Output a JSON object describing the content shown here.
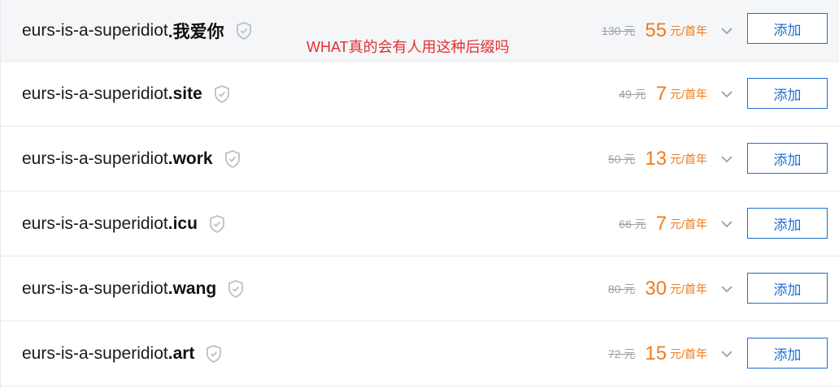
{
  "annotation": "WHAT真的会有人用这种后缀吗",
  "colors": {
    "price_accent": "#ef7c1a",
    "button_border": "#1f6fd1",
    "annotation": "#e0302e"
  },
  "icons": {
    "verified": "shield-check-icon",
    "expand": "chevron-down-icon"
  },
  "rows": [
    {
      "name": "eurs-is-a-superidiot",
      "tld": ".我爱你",
      "old_price": "130 元",
      "price": "55",
      "unit": "元/首年",
      "button": "添加"
    },
    {
      "name": "eurs-is-a-superidiot",
      "tld": ".site",
      "old_price": "49 元",
      "price": "7",
      "unit": "元/首年",
      "button": "添加"
    },
    {
      "name": "eurs-is-a-superidiot",
      "tld": ".work",
      "old_price": "50 元",
      "price": "13",
      "unit": "元/首年",
      "button": "添加"
    },
    {
      "name": "eurs-is-a-superidiot",
      "tld": ".icu",
      "old_price": "66 元",
      "price": "7",
      "unit": "元/首年",
      "button": "添加"
    },
    {
      "name": "eurs-is-a-superidiot",
      "tld": ".wang",
      "old_price": "80 元",
      "price": "30",
      "unit": "元/首年",
      "button": "添加"
    },
    {
      "name": "eurs-is-a-superidiot",
      "tld": ".art",
      "old_price": "72 元",
      "price": "15",
      "unit": "元/首年",
      "button": "添加"
    }
  ]
}
